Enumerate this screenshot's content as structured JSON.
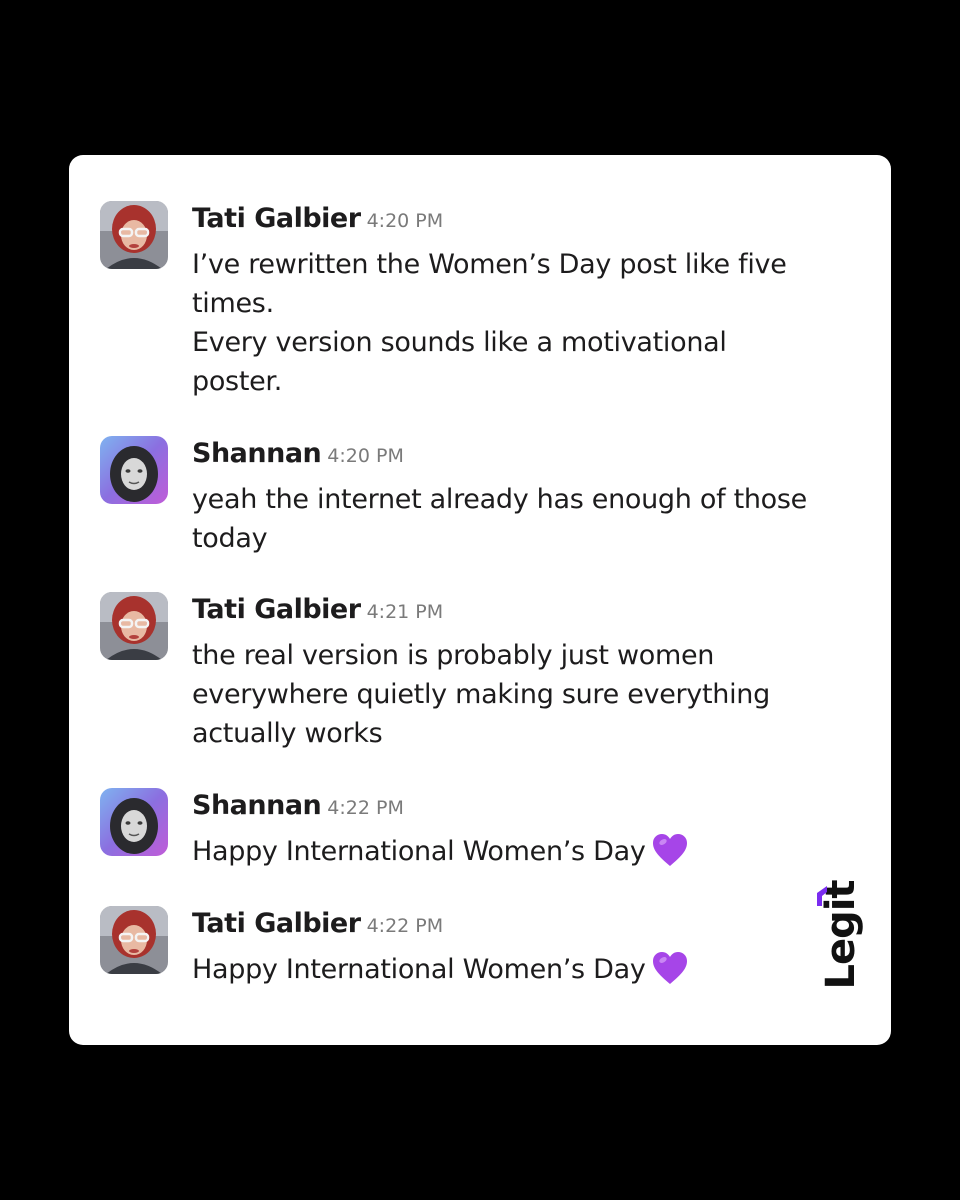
{
  "messages": [
    {
      "author": "Tati Galbier",
      "time": "4:20 PM",
      "avatar_icon": "avatar-photo-tati",
      "lines": [
        "I’ve rewritten the Women’s Day post like five",
        "times.",
        "Every version sounds like a motivational",
        "poster."
      ]
    },
    {
      "author": "Shannan",
      "time": "4:20 PM",
      "avatar_icon": "avatar-photo-shannan",
      "lines": [
        "yeah the internet already has enough of those",
        "today"
      ]
    },
    {
      "author": "Tati Galbier",
      "time": "4:21 PM",
      "avatar_icon": "avatar-photo-tati",
      "lines": [
        "the real version is probably just women",
        "everywhere quietly making sure everything",
        "actually works"
      ]
    },
    {
      "author": "Shannan",
      "time": "4:22 PM",
      "avatar_icon": "avatar-photo-shannan",
      "lines": [
        "Happy International Women’s Day"
      ],
      "emoji": "purple-heart-icon"
    },
    {
      "author": "Tati Galbier",
      "time": "4:22 PM",
      "avatar_icon": "avatar-photo-tati",
      "lines": [
        "Happy International Women’s Day"
      ],
      "emoji": "purple-heart-icon"
    }
  ],
  "watermark": {
    "text": "Legit",
    "accent_color": "#7a2cf0"
  },
  "colors": {
    "background": "#000000",
    "card": "#ffffff",
    "text": "#1d1c1d",
    "timestamp": "#7a7a7a",
    "heart": "#a645e8"
  }
}
